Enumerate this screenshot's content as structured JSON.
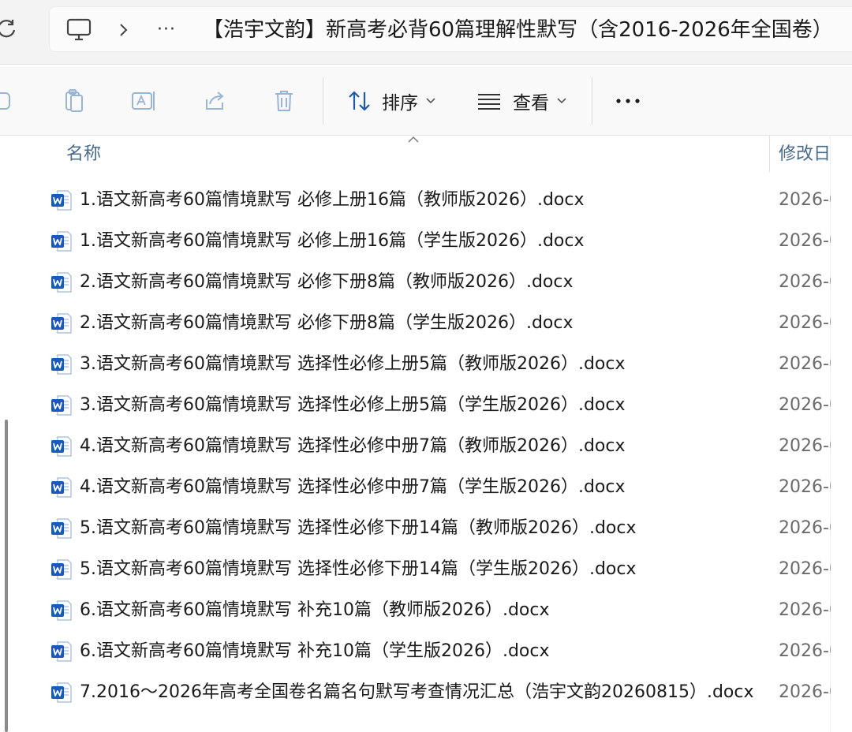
{
  "breadcrumb": {
    "overflow_label": "···",
    "folder_name": "【浩宇文韵】新高考必背60篇理解性默写（含2016-2026年全国卷）"
  },
  "toolbar": {
    "sort_label": "排序",
    "view_label": "查看",
    "more_label": "···"
  },
  "columns": {
    "name_header": "名称",
    "modified_header": "修改日"
  },
  "files": [
    {
      "name": "1.语文新高考60篇情境默写 必修上册16篇（教师版2026）.docx",
      "modified": "2026-0"
    },
    {
      "name": "1.语文新高考60篇情境默写 必修上册16篇（学生版2026）.docx",
      "modified": "2026-0"
    },
    {
      "name": "2.语文新高考60篇情境默写 必修下册8篇（教师版2026）.docx",
      "modified": "2026-0"
    },
    {
      "name": "2.语文新高考60篇情境默写 必修下册8篇（学生版2026）.docx",
      "modified": "2026-0"
    },
    {
      "name": "3.语文新高考60篇情境默写 选择性必修上册5篇（教师版2026）.docx",
      "modified": "2026-0"
    },
    {
      "name": "3.语文新高考60篇情境默写 选择性必修上册5篇（学生版2026）.docx",
      "modified": "2026-0"
    },
    {
      "name": "4.语文新高考60篇情境默写 选择性必修中册7篇（教师版2026）.docx",
      "modified": "2026-0"
    },
    {
      "name": "4.语文新高考60篇情境默写 选择性必修中册7篇（学生版2026）.docx",
      "modified": "2026-0"
    },
    {
      "name": "5.语文新高考60篇情境默写 选择性必修下册14篇（教师版2026）.docx",
      "modified": "2026-0"
    },
    {
      "name": "5.语文新高考60篇情境默写 选择性必修下册14篇（学生版2026）.docx",
      "modified": "2026-0"
    },
    {
      "name": "6.语文新高考60篇情境默写 补充10篇（教师版2026）.docx",
      "modified": "2026-0"
    },
    {
      "name": "6.语文新高考60篇情境默写 补充10篇（学生版2026）.docx",
      "modified": "2026-0"
    },
    {
      "name": "7.2016～2026年高考全国卷名篇名句默写考查情况汇总（浩宇文韵20260815）.docx",
      "modified": "2026-0"
    }
  ],
  "colors": {
    "word_icon_blue": "#185abd",
    "header_text": "#4a6a8a",
    "date_text": "#6b6b6b"
  }
}
